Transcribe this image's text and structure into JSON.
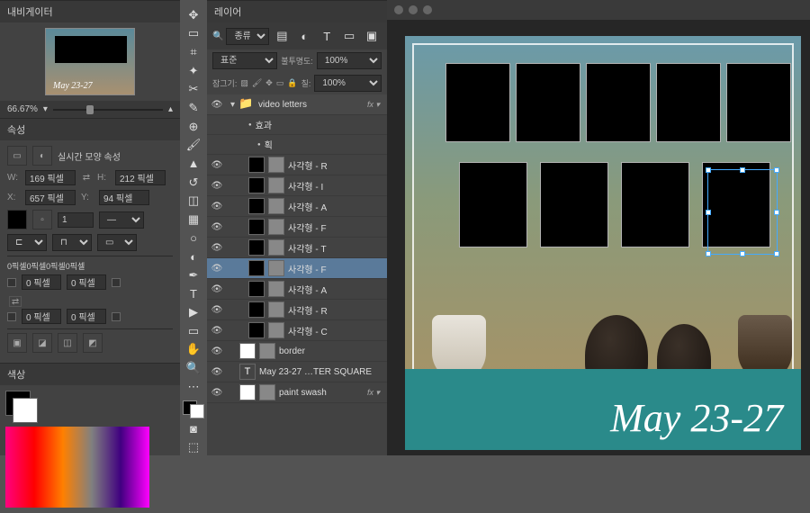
{
  "panels": {
    "navigator": "내비게이터",
    "properties": "속성",
    "colors": "색상",
    "layers": "레이어"
  },
  "nav": {
    "thumb_text": "May 23-27",
    "zoom": "66.67%"
  },
  "props": {
    "title": "실시간 모양 속성",
    "w_label": "W:",
    "w_value": "169 픽셀",
    "h_label": "H:",
    "h_value": "212 픽셀",
    "x_label": "X:",
    "x_value": "657 픽셀",
    "y_label": "Y:",
    "y_value": "94 픽셀",
    "shape_label": "0픽셀0픽셀0픽셀0픽셀",
    "corner_tl": "0 픽셀",
    "corner_tr": "0 픽셀",
    "corner_bl": "0 픽셀",
    "corner_br": "0 픽셀"
  },
  "layers": {
    "filter_label": "종류",
    "blend_mode": "표준",
    "opacity_label": "불투명도:",
    "opacity_value": "100%",
    "lock_label": "잠그기:",
    "fill_label": "칠:",
    "fill_value": "100%",
    "items": [
      {
        "name": "video letters",
        "type": "group",
        "fx": true
      },
      {
        "name": "효과",
        "type": "sub",
        "indent": 2
      },
      {
        "name": "획",
        "type": "sub",
        "indent": 3
      },
      {
        "name": "사각형 - R",
        "type": "shape",
        "indent": 2
      },
      {
        "name": "사각형 - I",
        "type": "shape",
        "indent": 2
      },
      {
        "name": "사각형 - A",
        "type": "shape",
        "indent": 2
      },
      {
        "name": "사각형 - F",
        "type": "shape",
        "indent": 2
      },
      {
        "name": "사각형 - T",
        "type": "shape",
        "indent": 2
      },
      {
        "name": "사각형 - F",
        "type": "shape",
        "indent": 2,
        "selected": true
      },
      {
        "name": "사각형 - A",
        "type": "shape",
        "indent": 2
      },
      {
        "name": "사각형 - R",
        "type": "shape",
        "indent": 2
      },
      {
        "name": "사각형 - C",
        "type": "shape",
        "indent": 2
      },
      {
        "name": "border",
        "type": "shape-white",
        "indent": 1
      },
      {
        "name": "May 23-27 …TER SQUARE",
        "type": "text",
        "indent": 1
      },
      {
        "name": "paint swash",
        "type": "shape-white",
        "indent": 1,
        "fx": true
      }
    ]
  },
  "canvas": {
    "text": "May 23-27"
  }
}
